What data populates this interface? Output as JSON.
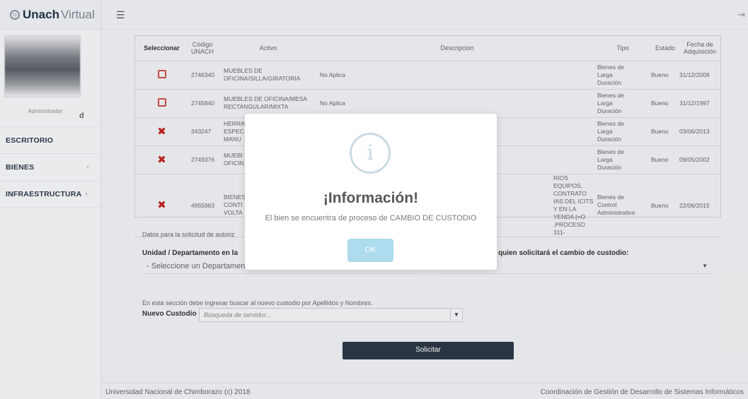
{
  "brand": {
    "part1": "Unach",
    "part2": "Virtual"
  },
  "profile": {
    "name_fragment": "d",
    "role": "Administrador"
  },
  "nav": [
    {
      "label": "ESCRITORIO",
      "chevron": ""
    },
    {
      "label": "BIENES",
      "chevron": "‹"
    },
    {
      "label": "INFRAESTRUCTURA",
      "chevron": "‹"
    }
  ],
  "table": {
    "headers": {
      "seleccionar": "Seleccionar",
      "codigo_1": "Código",
      "codigo_2": "UNACH",
      "activo": "Activo",
      "descripcion": "Descripcion",
      "tipo": "Tipo",
      "estado": "Estado",
      "fecha_1": "Fecha de",
      "fecha_2": "Adquisición"
    },
    "rows": [
      {
        "check": "box",
        "codigo": "2746340",
        "activo_1": "MUEBLES DE",
        "activo_2": "OFICINA/SILLA/GIRATORIA",
        "descripcion": "No Aplica",
        "tipo_1": "Bienes de",
        "tipo_2": "Larga",
        "tipo_3": "Duración",
        "estado": "Bueno",
        "fecha": "31/12/2008"
      },
      {
        "check": "box",
        "codigo": "2745840",
        "activo_1": "MUEBLES DE OFICINA/MESA",
        "activo_2": "RECTANGULAR/MIXTA",
        "descripcion": "No Aplica",
        "tipo_1": "Bienes de",
        "tipo_2": "Larga",
        "tipo_3": "Duración",
        "estado": "Bueno",
        "fecha": "31/12/1997"
      },
      {
        "check": "x",
        "codigo": "343247",
        "activo_1": "HERRA",
        "activo_2": "ESPEC",
        "activo_3": "MANU",
        "descripcion": "",
        "tipo_1": "Bienes de",
        "tipo_2": "Larga",
        "tipo_3": "Duración",
        "estado": "Bueno",
        "fecha": "03/06/2013"
      },
      {
        "check": "x",
        "codigo": "2749376",
        "activo_1": "MUEBI",
        "activo_2": "OFICIN",
        "descripcion": "",
        "tipo_1": "Bienes de",
        "tipo_2": "Larga",
        "tipo_3": "Duración",
        "estado": "Bueno",
        "fecha": "09/05/2002"
      },
      {
        "check": "x",
        "codigo": "4955983",
        "activo_1": "BIENES",
        "activo_2": "CONTI",
        "activo_3": "VOLTA",
        "descripcion_1": "RIOS EQUIPOS, CONTRATO",
        "descripcion_2": "IAS DEL ICITS Y EN LA",
        "descripcion_3": "YENDA [=O ,PROCESO 311-",
        "tipo_1": "Bienes de",
        "tipo_2": "Control",
        "tipo_3": "Administrativo",
        "estado": "Bueno",
        "fecha": "22/06/2015"
      }
    ]
  },
  "form": {
    "intro": "Datos para la solicitud de autoriz",
    "unidad_label": "Unidad / Departamento en la",
    "quien_label": "quien solicitará el cambio de custodio:",
    "departamento_placeholder": "- Seleccione un Departamento",
    "nuevo_intro": "En esta sección debe ingresar buscar al nuevo custodio por Apellidos y Nombres.",
    "nuevo_label": "Nuevo Custodio",
    "search_placeholder": "Búsqueda de servidor...",
    "solicitar": "Solicitar"
  },
  "footer": {
    "left": "Universidad Nacional de Chimborazo (c) 2018",
    "right": "Coordinación de Gestión de Desarrollo de Sistemas Informáticos"
  },
  "modal": {
    "icon": "i",
    "title": "¡Información!",
    "text": "El bien se encuentra de proceso de CAMBIO DE CUSTODIO",
    "ok": "OK"
  },
  "colors": {
    "accent": "#acdced",
    "danger": "#c0241f",
    "dark_button": "#2b3846"
  }
}
